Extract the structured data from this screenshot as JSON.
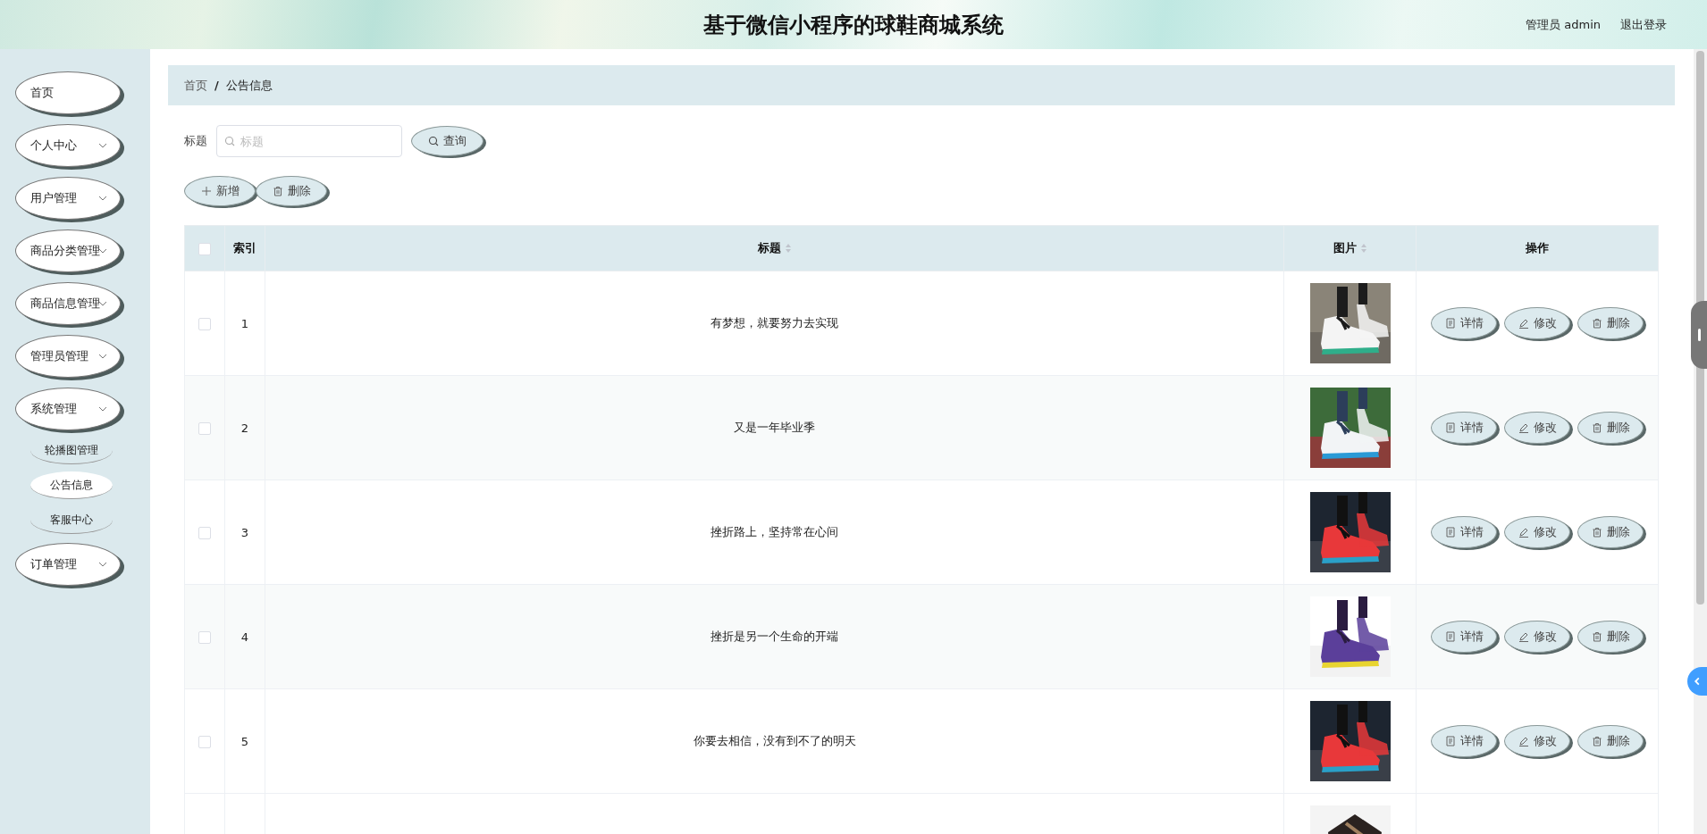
{
  "header": {
    "title": "基于微信小程序的球鞋商城系统",
    "user": "管理员 admin",
    "logout": "退出登录"
  },
  "sidebar": {
    "items": [
      {
        "label": "首页",
        "kind": "link"
      },
      {
        "label": "个人中心",
        "kind": "menu"
      },
      {
        "label": "用户管理",
        "kind": "menu"
      },
      {
        "label": "商品分类管理",
        "kind": "menu"
      },
      {
        "label": "商品信息管理",
        "kind": "menu"
      },
      {
        "label": "管理员管理",
        "kind": "menu"
      },
      {
        "label": "系统管理",
        "kind": "menu",
        "children": [
          {
            "label": "轮播图管理",
            "selected": false
          },
          {
            "label": "公告信息",
            "selected": true
          },
          {
            "label": "客服中心",
            "selected": false
          }
        ]
      },
      {
        "label": "订单管理",
        "kind": "menu"
      }
    ]
  },
  "breadcrumb": {
    "items": [
      "首页",
      "公告信息"
    ],
    "separator": "/"
  },
  "search": {
    "label": "标题",
    "placeholder": "标题",
    "button": "查询"
  },
  "toolbar": [
    {
      "label": "新增",
      "kind": "add"
    },
    {
      "label": "删除",
      "kind": "delete"
    }
  ],
  "table": {
    "header_checked": false,
    "columns": [
      {
        "label": "索引",
        "sortable": false
      },
      {
        "label": "标题",
        "sortable": true
      },
      {
        "label": "图片",
        "sortable": true
      },
      {
        "label": "操作",
        "sortable": false
      }
    ],
    "rows": [
      {
        "checked": false,
        "index": "1",
        "title": "有梦想，就要努力去实现",
        "actions": [
          "详情",
          "修改",
          "删除"
        ]
      },
      {
        "checked": false,
        "index": "2",
        "title": "又是一年毕业季",
        "actions": [
          "详情",
          "修改",
          "删除"
        ]
      },
      {
        "checked": false,
        "index": "3",
        "title": "挫折路上，坚持常在心间",
        "actions": [
          "详情",
          "修改",
          "删除"
        ]
      },
      {
        "checked": false,
        "index": "4",
        "title": "挫折是另一个生命的开端",
        "actions": [
          "详情",
          "修改",
          "删除"
        ]
      },
      {
        "checked": false,
        "index": "5",
        "title": "你要去相信，没有到不了的明天",
        "actions": [
          "详情",
          "修改",
          "删除"
        ]
      }
    ]
  }
}
